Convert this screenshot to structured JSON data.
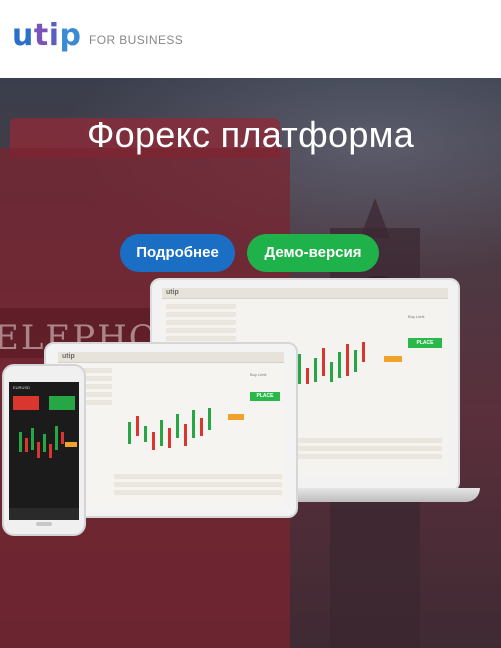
{
  "header": {
    "logo": {
      "u": "u",
      "t": "t",
      "i": "i",
      "p": "p"
    },
    "tagline": "FOR BUSINESS"
  },
  "hero": {
    "title": "Форекс платформа",
    "buttons": {
      "details": "Подробнее",
      "demo": "Демо-версия"
    },
    "background_sign": "ELEPHONE"
  },
  "devices": {
    "laptop": {
      "brand": "utip",
      "buy_limit": "Buy Limit",
      "place": "PLACE"
    },
    "tablet": {
      "brand": "utip",
      "buy_limit": "Buy Limit",
      "place": "PLACE"
    },
    "phone": {
      "symbol": "EURUSD"
    }
  },
  "colors": {
    "brand_blue": "#1a6fc5",
    "demo_green": "#1fb24a",
    "candle_green": "#26a644",
    "candle_red": "#d9362f"
  }
}
